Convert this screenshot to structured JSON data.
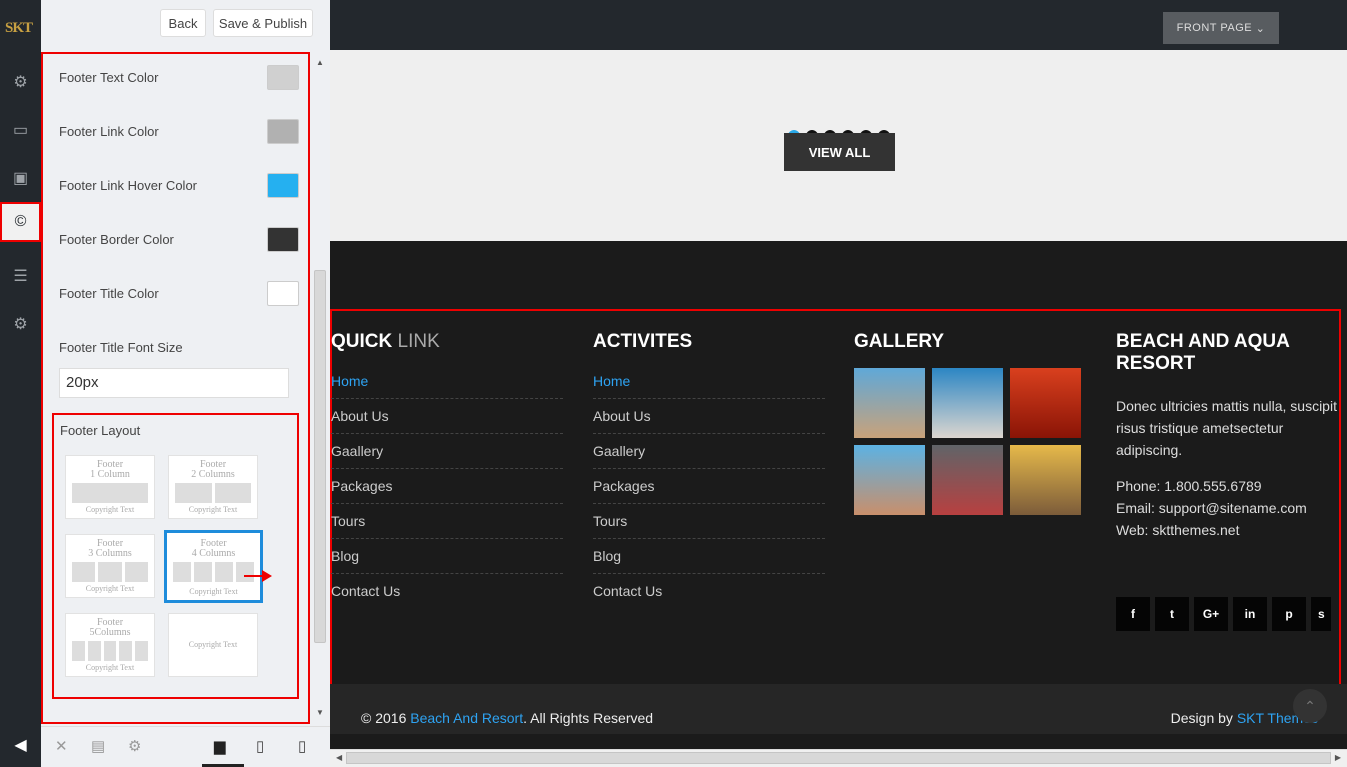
{
  "rail": {
    "logo": "SKT"
  },
  "topbar": {
    "back": "Back",
    "publish": "Save & Publish"
  },
  "colors": [
    {
      "label": "Footer Text Color",
      "value": "#d0d0d0"
    },
    {
      "label": "Footer Link Color",
      "value": "#b1b1b1"
    },
    {
      "label": "Footer Link Hover Color",
      "value": "#25b0f0"
    },
    {
      "label": "Footer Border Color",
      "value": "#333333"
    },
    {
      "label": "Footer Title Color",
      "value": "#ffffff"
    }
  ],
  "title_font": {
    "label": "Footer Title Font Size",
    "value": "20px"
  },
  "layout": {
    "label": "Footer Layout",
    "options": [
      {
        "line1": "Footer",
        "line2": "1 Column",
        "copy": "Copyright Text"
      },
      {
        "line1": "Footer",
        "line2": "2 Columns",
        "copy": "Copyright Text"
      },
      {
        "line1": "Footer",
        "line2": "3 Columns",
        "copy": "Copyright Text"
      },
      {
        "line1": "Footer",
        "line2": "4 Columns",
        "copy": "Copyright Text"
      },
      {
        "line1": "Footer",
        "line2": "5Columns",
        "copy": "Copyright Text"
      },
      {
        "line1": "",
        "line2": "",
        "copy": "Copyright Text"
      }
    ],
    "selected": 3
  },
  "preview": {
    "front_page": "FRONT PAGE",
    "view_all": "VIEW ALL",
    "quick": {
      "bold": "QUICK",
      "thin": "LINK",
      "items": [
        "Home",
        "About Us",
        "Gaallery",
        "Packages",
        "Tours",
        "Blog",
        "Contact Us"
      ]
    },
    "activities": {
      "title": "ACTIVITES",
      "items": [
        "Home",
        "About Us",
        "Gaallery",
        "Packages",
        "Tours",
        "Blog",
        "Contact Us"
      ]
    },
    "gallery": {
      "title": "GALLERY"
    },
    "resort": {
      "title": "BEACH AND AQUA RESORT",
      "text": "Donec ultricies mattis nulla, suscipit risus tristique ametsectetur adipiscing.",
      "phone": "Phone: 1.800.555.6789",
      "email": "Email: support@sitename.com",
      "web": "Web: sktthemes.net"
    },
    "social": [
      "f",
      "t",
      "G+",
      "in",
      "p",
      "s"
    ],
    "copy_pre": "© 2016 ",
    "copy_link": "Beach And Resort",
    "copy_post": ". All Rights Reserved",
    "design_pre": "Design by ",
    "design_link": "SKT Themes"
  }
}
